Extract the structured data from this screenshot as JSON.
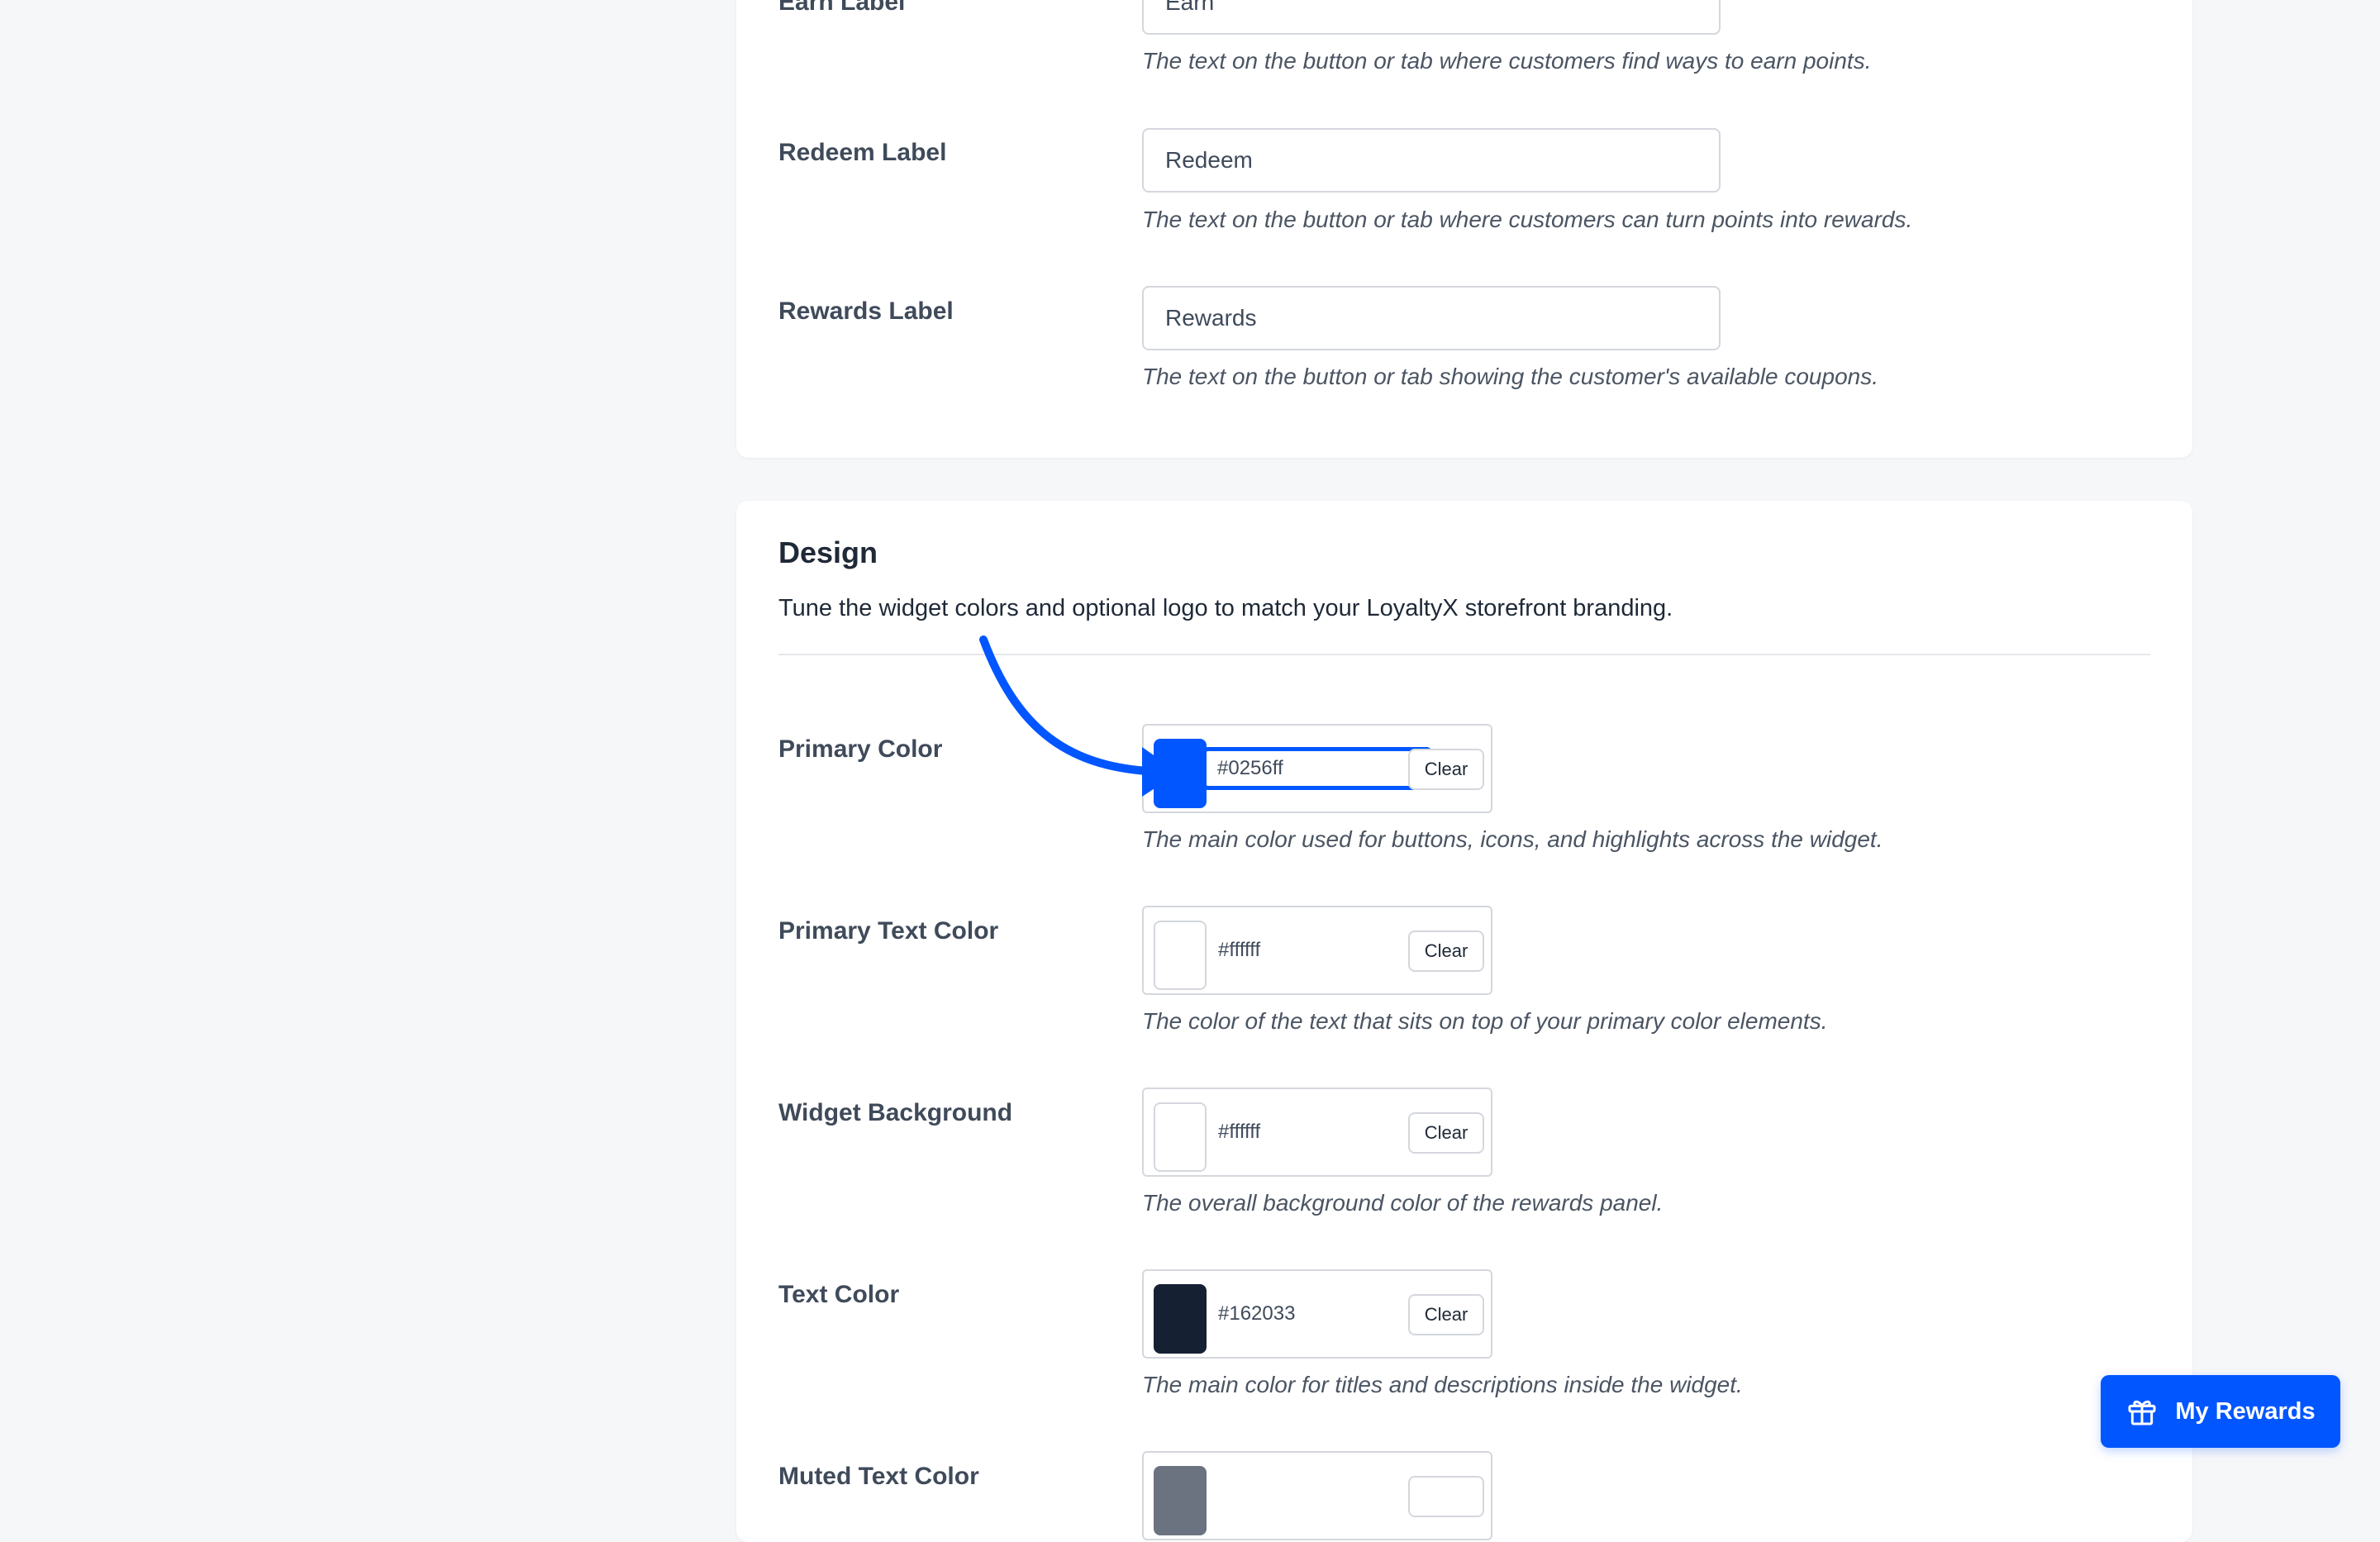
{
  "labels_section": {
    "earn": {
      "label": "Earn Label",
      "value": "Earn",
      "help": "The text on the button or tab where customers find ways to earn points."
    },
    "redeem": {
      "label": "Redeem Label",
      "value": "Redeem",
      "help": "The text on the button or tab where customers can turn points into rewards."
    },
    "rewards": {
      "label": "Rewards Label",
      "value": "Rewards",
      "help": "The text on the button or tab showing the customer's available coupons."
    }
  },
  "design_section": {
    "title": "Design",
    "description": "Tune the widget colors and optional logo to match your LoyaltyX storefront branding.",
    "clear_label": "Clear",
    "fields": {
      "primary_color": {
        "label": "Primary Color",
        "value": "#0256ff",
        "swatch": "#0256ff",
        "help": "The main color used for buttons, icons, and highlights across the widget."
      },
      "primary_text_color": {
        "label": "Primary Text Color",
        "value": "#ffffff",
        "swatch": "#ffffff",
        "help": "The color of the text that sits on top of your primary color elements."
      },
      "widget_background": {
        "label": "Widget Background",
        "value": "#ffffff",
        "swatch": "#ffffff",
        "help": "The overall background color of the rewards panel."
      },
      "text_color": {
        "label": "Text Color",
        "value": "#162033",
        "swatch": "#162033",
        "help": "The main color for titles and descriptions inside the widget."
      },
      "muted_text_color": {
        "label": "Muted Text Color",
        "swatch": "#6b7280"
      }
    }
  },
  "floating_button": {
    "label": "My Rewards",
    "icon": "gift-icon"
  },
  "colors": {
    "accent": "#0256ff",
    "page_background": "#f6f7f9",
    "card_background": "#ffffff"
  }
}
